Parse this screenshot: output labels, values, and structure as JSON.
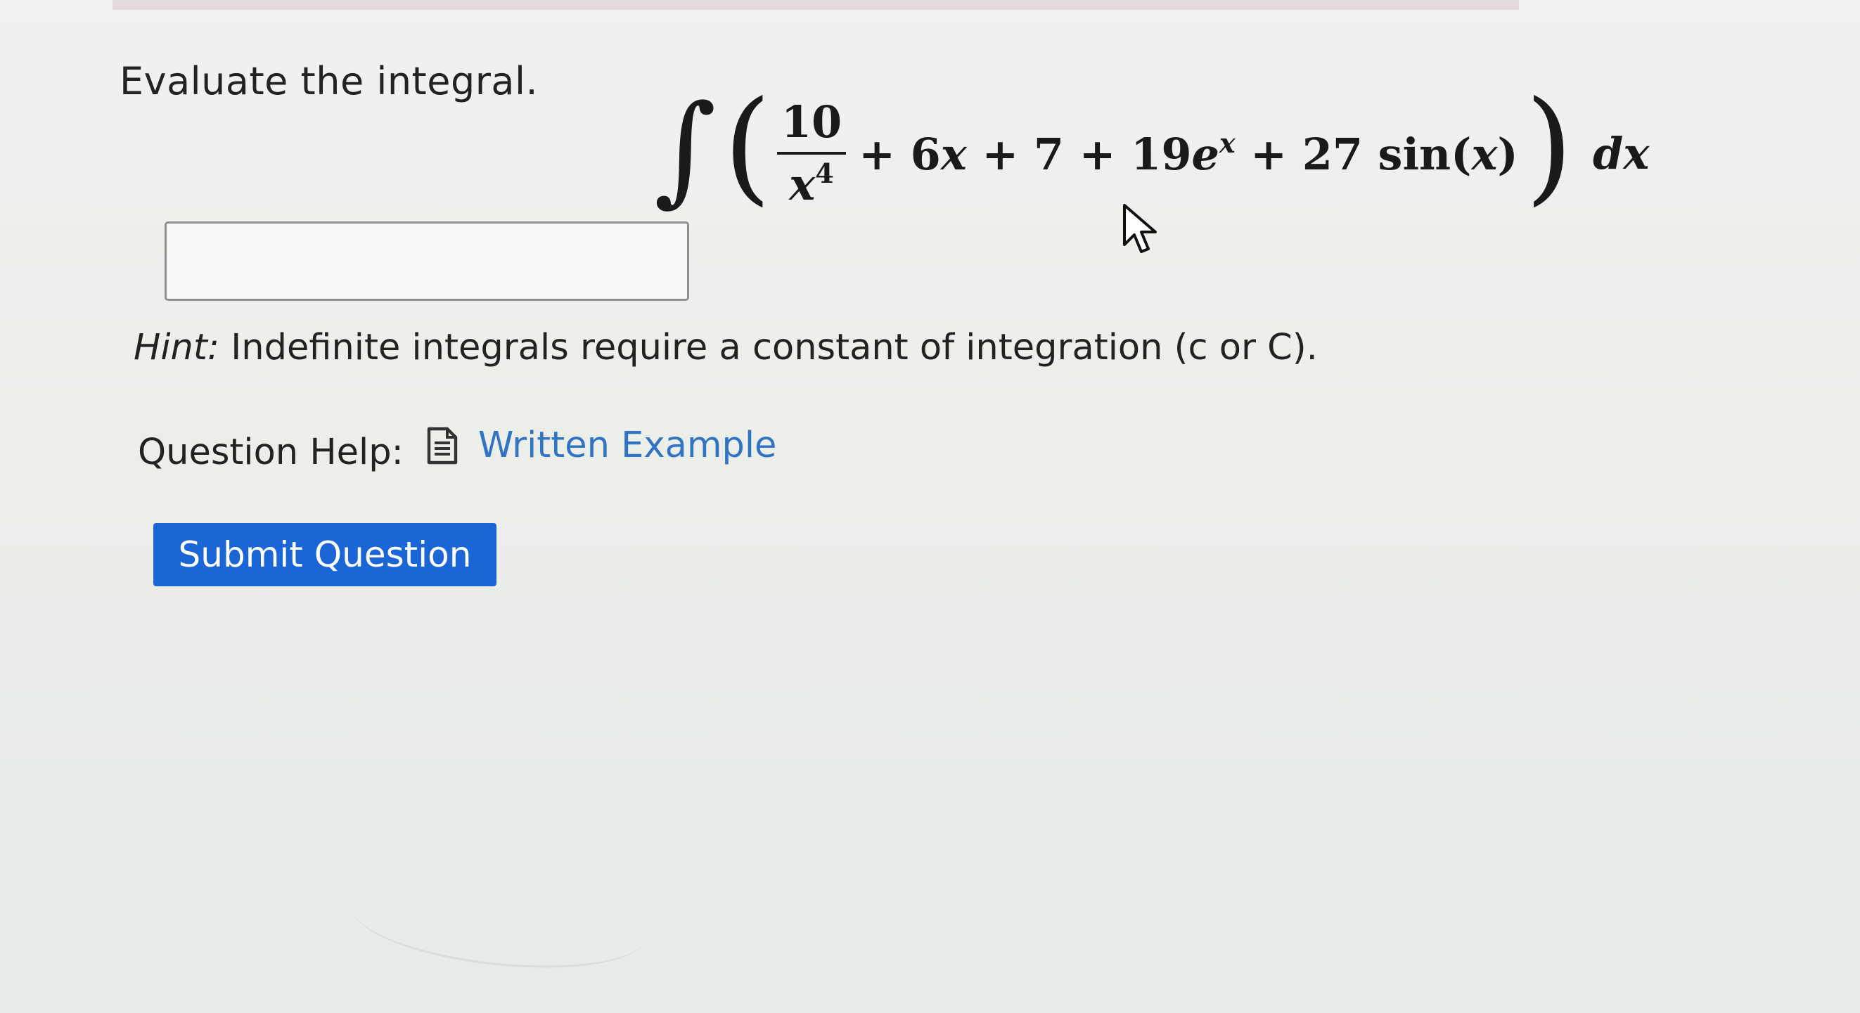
{
  "question": {
    "prompt": "Evaluate the integral.",
    "integral": {
      "integral_symbol": "∫",
      "open_paren": "(",
      "close_paren": ")",
      "fraction_numerator": "10",
      "fraction_denominator_base": "x",
      "fraction_denominator_exponent": "4",
      "term_plus_1": "+ 6",
      "term_x_1": "x",
      "term_plus_2": " + 7 + 19",
      "term_e": "e",
      "term_e_exponent": "x",
      "term_plus_3": " + 27 sin(",
      "term_x_2": "x",
      "term_close": ")",
      "differential": "d",
      "differential_var": "x"
    },
    "answer_input": {
      "value": "",
      "placeholder": ""
    },
    "hint": {
      "label": "Hint:",
      "text": " Indefinite integrals require a constant of integration (c or C)."
    },
    "help": {
      "label": "Question Help:",
      "link_label": "Written Example",
      "link_icon": "document-icon"
    },
    "submit_label": "Submit Question"
  },
  "colors": {
    "link": "#3174c4",
    "button": "#1a66d6",
    "button_text": "#ffffff"
  }
}
